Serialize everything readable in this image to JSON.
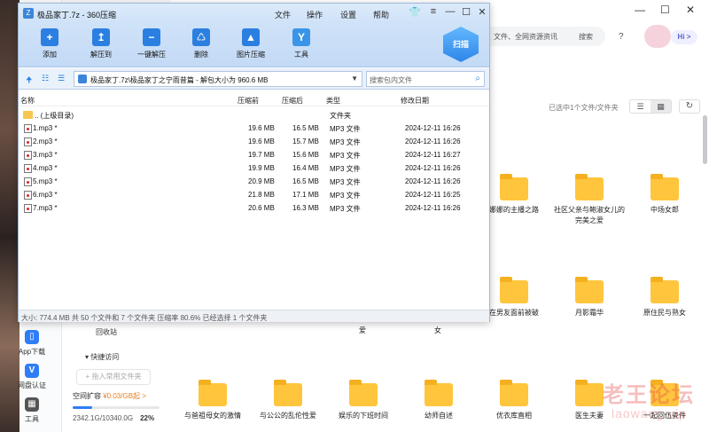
{
  "zip": {
    "title": "极品家丁.7z - 360压缩",
    "menus": [
      "文件",
      "操作",
      "设置",
      "帮助"
    ],
    "toolbar": [
      "添加",
      "解压到",
      "一键解压",
      "删除",
      "图片压缩",
      "工具"
    ],
    "scan_label": "扫描",
    "path": "极品家丁.7z\\极品家丁之宁雨昔篇 - 解包大小为 960.6 MB",
    "search_placeholder": "搜索包内文件",
    "columns": [
      "名称",
      "压缩前",
      "压缩后",
      "类型",
      "修改日期"
    ],
    "parent": {
      "name": ".. (上级目录)",
      "type": "文件夹"
    },
    "files": [
      {
        "name": "1.mp3 *",
        "before": "19.6 MB",
        "after": "16.5 MB",
        "type": "MP3 文件",
        "date": "2024-12-11 16:26"
      },
      {
        "name": "2.mp3 *",
        "before": "19.6 MB",
        "after": "15.7 MB",
        "type": "MP3 文件",
        "date": "2024-12-11 16:26"
      },
      {
        "name": "3.mp3 *",
        "before": "19.7 MB",
        "after": "15.6 MB",
        "type": "MP3 文件",
        "date": "2024-12-11 16:27"
      },
      {
        "name": "4.mp3 *",
        "before": "19.9 MB",
        "after": "16.4 MB",
        "type": "MP3 文件",
        "date": "2024-12-11 16:26"
      },
      {
        "name": "5.mp3 *",
        "before": "20.9 MB",
        "after": "16.5 MB",
        "type": "MP3 文件",
        "date": "2024-12-11 16:26"
      },
      {
        "name": "6.mp3 *",
        "before": "21.8 MB",
        "after": "17.1 MB",
        "type": "MP3 文件",
        "date": "2024-12-11 16:25"
      },
      {
        "name": "7.mp3 *",
        "before": "20.6 MB",
        "after": "16.3 MB",
        "type": "MP3 文件",
        "date": "2024-12-11 16:26"
      }
    ],
    "status": "大小: 774.4 MB 共 50 个文件和 7 个文件夹 压缩率 80.6% 已经选择 1 个文件夹"
  },
  "cloud": {
    "search_placeholder": "文件、全网资源资讯",
    "search_button": "搜索",
    "hi": "Hi >",
    "selection_info": "已选中1个文件/文件夹",
    "folders_row1": [
      "娜娜的主播之路",
      "社区父亲与鲍淑女儿的完美之爱",
      "中场女郎"
    ],
    "folders_row2": [
      "在男友面前被破",
      "月影霜华",
      "原住民与熟女"
    ],
    "folders_row2_tail": [
      "爱",
      "女"
    ],
    "folders_row3": [
      "与爸祖母女的激情",
      "与公公的乱伦性爱",
      "娱乐的下班时间",
      "幼师自述",
      "优衣库直相",
      "医生夫妻",
      "一起回伍瓷件"
    ],
    "left_nav": [
      "App下载",
      "网盘认证",
      "工具"
    ],
    "recycle": "回收站",
    "quick_access": "快捷访问",
    "add_quick": "+ 拖入常用文件夹",
    "space_label": "空间扩容",
    "space_price": "¥0.03/GB起 >",
    "usage": "2342.1G/10340.0G",
    "usage_pct": "22%",
    "usage_fraction": 0.22,
    "watermark": "老王论坛",
    "watermark_url": "laowang.vip"
  }
}
